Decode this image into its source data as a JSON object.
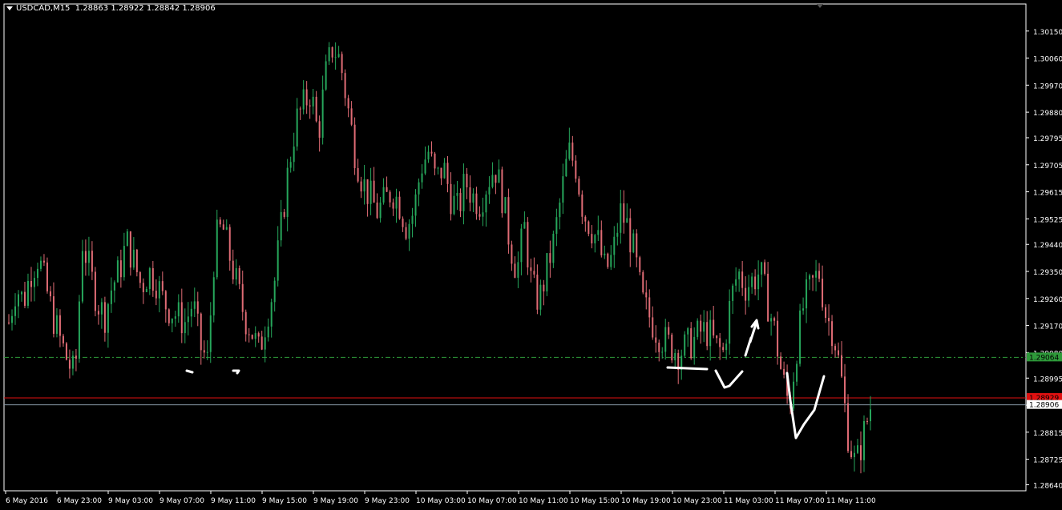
{
  "window": {
    "symbol_timeframe": "USDCAD,M15",
    "ohlc": "1.28863 1.28922 1.28842 1.28906"
  },
  "colors": {
    "background": "#000000",
    "bull": "#26a65b",
    "bear": "#e06c75",
    "axis": "#ffffff",
    "support_line": "#2e9a3a",
    "red_line": "#e01010",
    "bid_line": "#8a9aa8"
  },
  "price_levels": {
    "support": "1.29064",
    "red": "1.28929",
    "bid": "1.28906"
  },
  "chart_data": {
    "type": "candlestick",
    "y_ticks": [
      "1.30150",
      "1.30060",
      "1.29970",
      "1.29880",
      "1.29795",
      "1.29705",
      "1.29615",
      "1.29525",
      "1.29440",
      "1.29350",
      "1.29260",
      "1.29170",
      "1.29080",
      "1.28995",
      "1.28905",
      "1.28815",
      "1.28725",
      "1.28640"
    ],
    "x_ticks": [
      "6 May 2016",
      "6 May 23:00",
      "9 May 03:00",
      "9 May 07:00",
      "9 May 11:00",
      "9 May 15:00",
      "9 May 19:00",
      "9 May 23:00",
      "10 May 03:00",
      "10 May 07:00",
      "10 May 11:00",
      "10 May 15:00",
      "10 May 19:00",
      "10 May 23:00",
      "11 May 03:00",
      "11 May 07:00",
      "11 May 11:00"
    ],
    "ylim": [
      1.2862,
      1.3024
    ],
    "horizontal_lines": [
      {
        "price": 1.29064,
        "style": "dash-dot",
        "color": "#2e9a3a"
      },
      {
        "price": 1.28929,
        "style": "solid",
        "color": "#e01010"
      },
      {
        "price": 1.28906,
        "style": "solid",
        "color": "#8a9aa8"
      }
    ],
    "close_path": [
      1.2918,
      1.293,
      1.2925,
      1.2935,
      1.294,
      1.293,
      1.292,
      1.2912,
      1.2905,
      1.29,
      1.2945,
      1.2935,
      1.2925,
      1.292,
      1.293,
      1.2935,
      1.2945,
      1.2938,
      1.293,
      1.2935,
      1.2932,
      1.2925,
      1.2922,
      1.292,
      1.2918,
      1.2925,
      1.291,
      1.2905,
      1.2945,
      1.295,
      1.294,
      1.293,
      1.292,
      1.2915,
      1.2908,
      1.292,
      1.293,
      1.295,
      1.297,
      1.2985,
      1.299,
      1.2995,
      1.298,
      1.3,
      1.301,
      1.3005,
      1.299,
      1.2975,
      1.2965,
      1.296,
      1.2955,
      1.2958,
      1.2962,
      1.2958,
      1.295,
      1.2955,
      1.297,
      1.2975,
      1.2965,
      1.297,
      1.296,
      1.2955,
      1.2965,
      1.296,
      1.2958,
      1.2965,
      1.297,
      1.296,
      1.2945,
      1.2935,
      1.295,
      1.293,
      1.2925,
      1.2935,
      1.2945,
      1.296,
      1.2975,
      1.297,
      1.2955,
      1.295,
      1.2945,
      1.2935,
      1.294,
      1.2955,
      1.295,
      1.294,
      1.2925,
      1.292,
      1.2915,
      1.2912,
      1.291,
      1.2908,
      1.291,
      1.2912,
      1.2915,
      1.2915,
      1.291,
      1.2908,
      1.2925,
      1.2935,
      1.293,
      1.2932,
      1.2935,
      1.2925,
      1.2915,
      1.29,
      1.289,
      1.291,
      1.2925,
      1.293,
      1.2935,
      1.292,
      1.2915,
      1.29,
      1.288,
      1.287,
      1.288,
      1.289
    ],
    "annotations": "white hand-drawn marks"
  }
}
